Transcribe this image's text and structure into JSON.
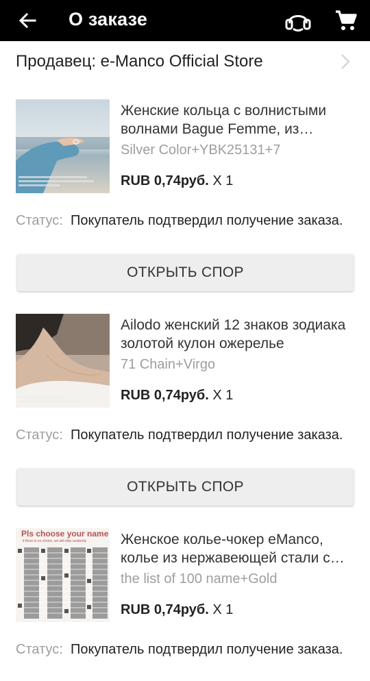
{
  "header": {
    "title": "О заказе",
    "back_icon": "arrow-left-icon",
    "support_icon": "headset-icon",
    "cart_icon": "cart-icon"
  },
  "seller": {
    "label": "Продавец: e-Manco Official Store",
    "chevron_icon": "chevron-right-icon"
  },
  "items": [
    {
      "name": "Женские кольца с волнистыми волнами Bague Femme, из нержавеющей стали",
      "variant": "Silver Color+YBK25131+7",
      "price": "RUB 0,74руб.",
      "qty": "X 1",
      "status_label": "Статус:",
      "status_text": "Покупатель подтвердил получение заказа.",
      "dispute_label": "ОТКРЫТЬ СПОР"
    },
    {
      "name": "Ailodo женский 12 знаков зодиака золотой кулон ожерелье",
      "variant": "71 Chain+Virgo",
      "price": "RUB 0,74руб.",
      "qty": "X 1",
      "status_label": "Статус:",
      "status_text": "Покупатель подтвердил получение заказа.",
      "dispute_label": "ОТКРЫТЬ СПОР"
    },
    {
      "name": "Женское колье-чокер eManco, колье из нержавеющей стали с именем",
      "variant": "the list of 100 name+Gold",
      "price": "RUB 0,74руб.",
      "qty": "X 1",
      "status_label": "Статус:",
      "status_text": "Покупатель подтвердил получение заказа.",
      "thumb_heading": "Pls choose your name",
      "thumb_subheading": "if there is no choice, we will ship randomly"
    }
  ]
}
